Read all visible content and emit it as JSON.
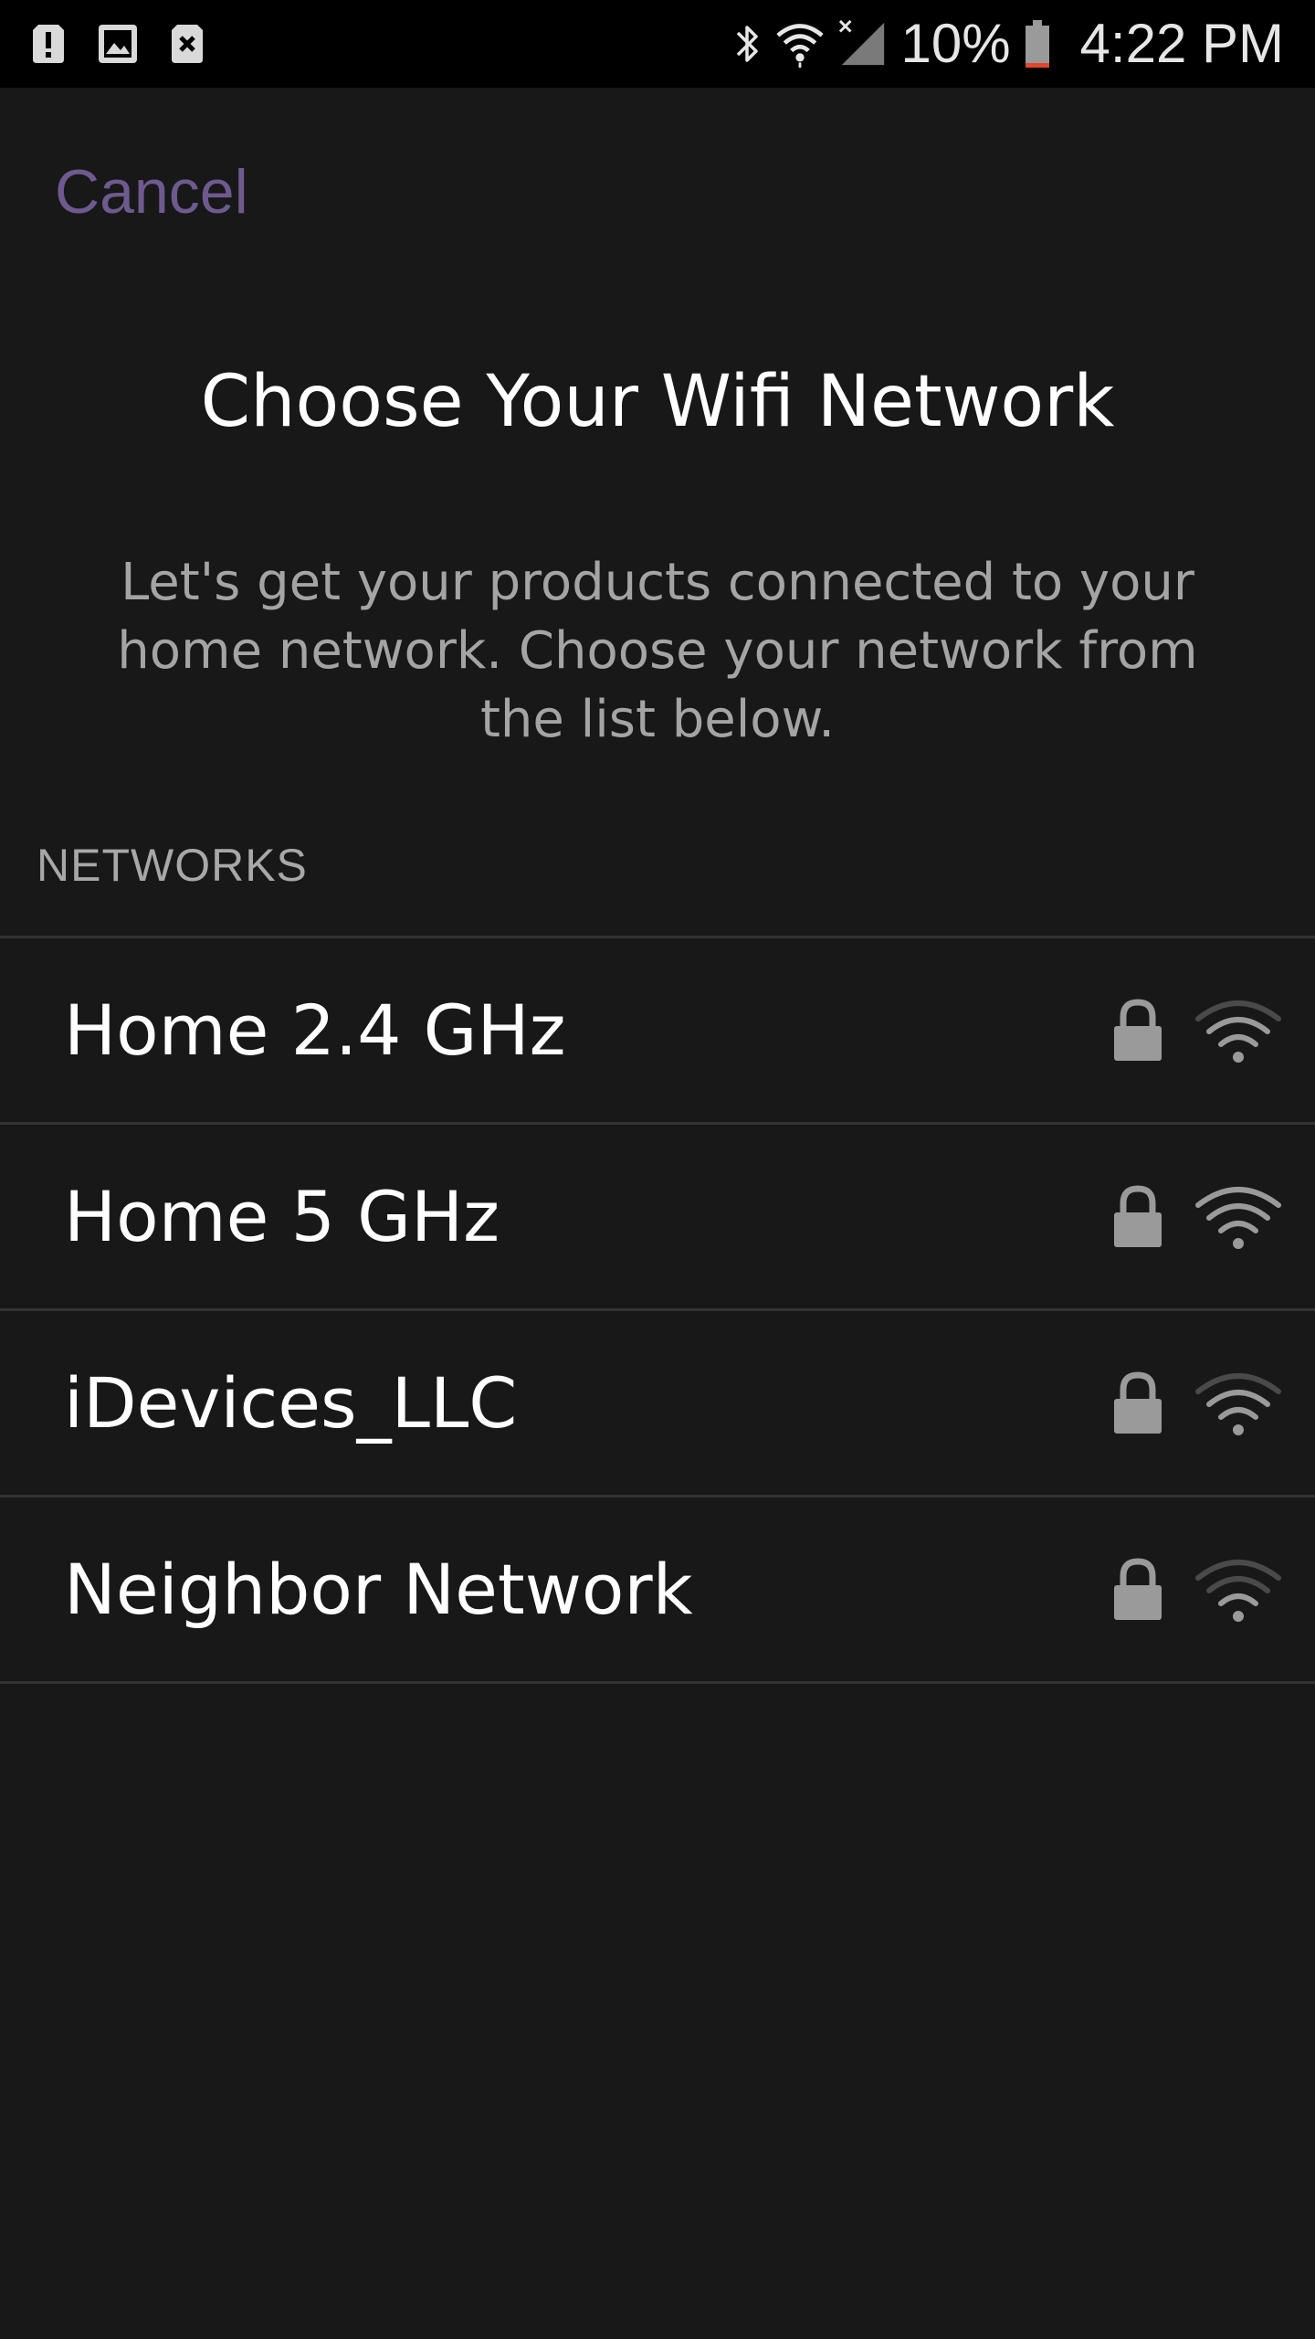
{
  "status_bar": {
    "left_icons": [
      "alert-icon",
      "image-icon",
      "sim-error-icon"
    ],
    "right_icons": [
      "bluetooth-icon",
      "wifi-status-icon",
      "cell-signal-icon",
      "battery-icon"
    ],
    "battery_percent": "10%",
    "clock": "4:22 PM",
    "battery_level": 0.1,
    "battery_low_color": "#e0482a"
  },
  "header": {
    "cancel_label": "Cancel",
    "title": "Choose Your Wifi Network",
    "instructions": "Let's get your products connected to your home network. Choose your network from the list below."
  },
  "networks": {
    "section_label": "NETWORKS",
    "items": [
      {
        "name": "Home 2.4 GHz",
        "secured": true,
        "icons": [
          "lock-icon",
          "wifi-signal-icon"
        ]
      },
      {
        "name": "Home 5 GHz",
        "secured": true,
        "icons": [
          "lock-icon",
          "wifi-signal-icon"
        ]
      },
      {
        "name": "iDevices_LLC",
        "secured": true,
        "icons": [
          "lock-icon",
          "wifi-signal-icon"
        ]
      },
      {
        "name": "Neighbor Network",
        "secured": true,
        "icons": [
          "lock-icon",
          "wifi-signal-icon"
        ]
      }
    ]
  },
  "colors": {
    "background": "#181818",
    "status_bar_bg": "#000000",
    "accent": "#6d5a8e",
    "divider": "#333333",
    "secondary_text": "#a4a4a4",
    "icon_gray": "#9a9a9a"
  }
}
